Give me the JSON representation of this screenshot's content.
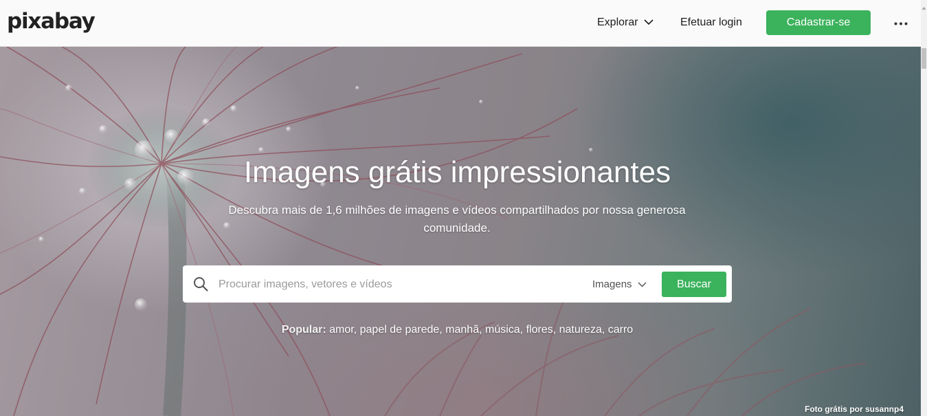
{
  "header": {
    "logo": "pixabay",
    "explore_label": "Explorar",
    "login_label": "Efetuar login",
    "signup_label": "Cadastrar-se"
  },
  "hero": {
    "title": "Imagens grátis impressionantes",
    "subtitle": "Descubra mais de 1,6 milhões de imagens e vídeos compartilhados por nossa generosa comunidade.",
    "search": {
      "placeholder": "Procurar imagens, vetores e vídeos",
      "type_selected": "Imagens",
      "button_label": "Buscar"
    },
    "popular": {
      "label": "Popular:",
      "tags": [
        "amor",
        "papel de parede",
        "manhã",
        "música",
        "flores",
        "natureza",
        "carro"
      ]
    },
    "credit": "Foto grátis por susannp4"
  },
  "icons": {
    "explore_chevron": "chevron-down-icon",
    "more": "more-horizontal-icon",
    "search": "search-icon",
    "type_chevron": "chevron-down-icon"
  },
  "colors": {
    "accent": "#3bb25c",
    "topbar_bg": "#fafafa",
    "text_dark": "#1c1c1c"
  }
}
